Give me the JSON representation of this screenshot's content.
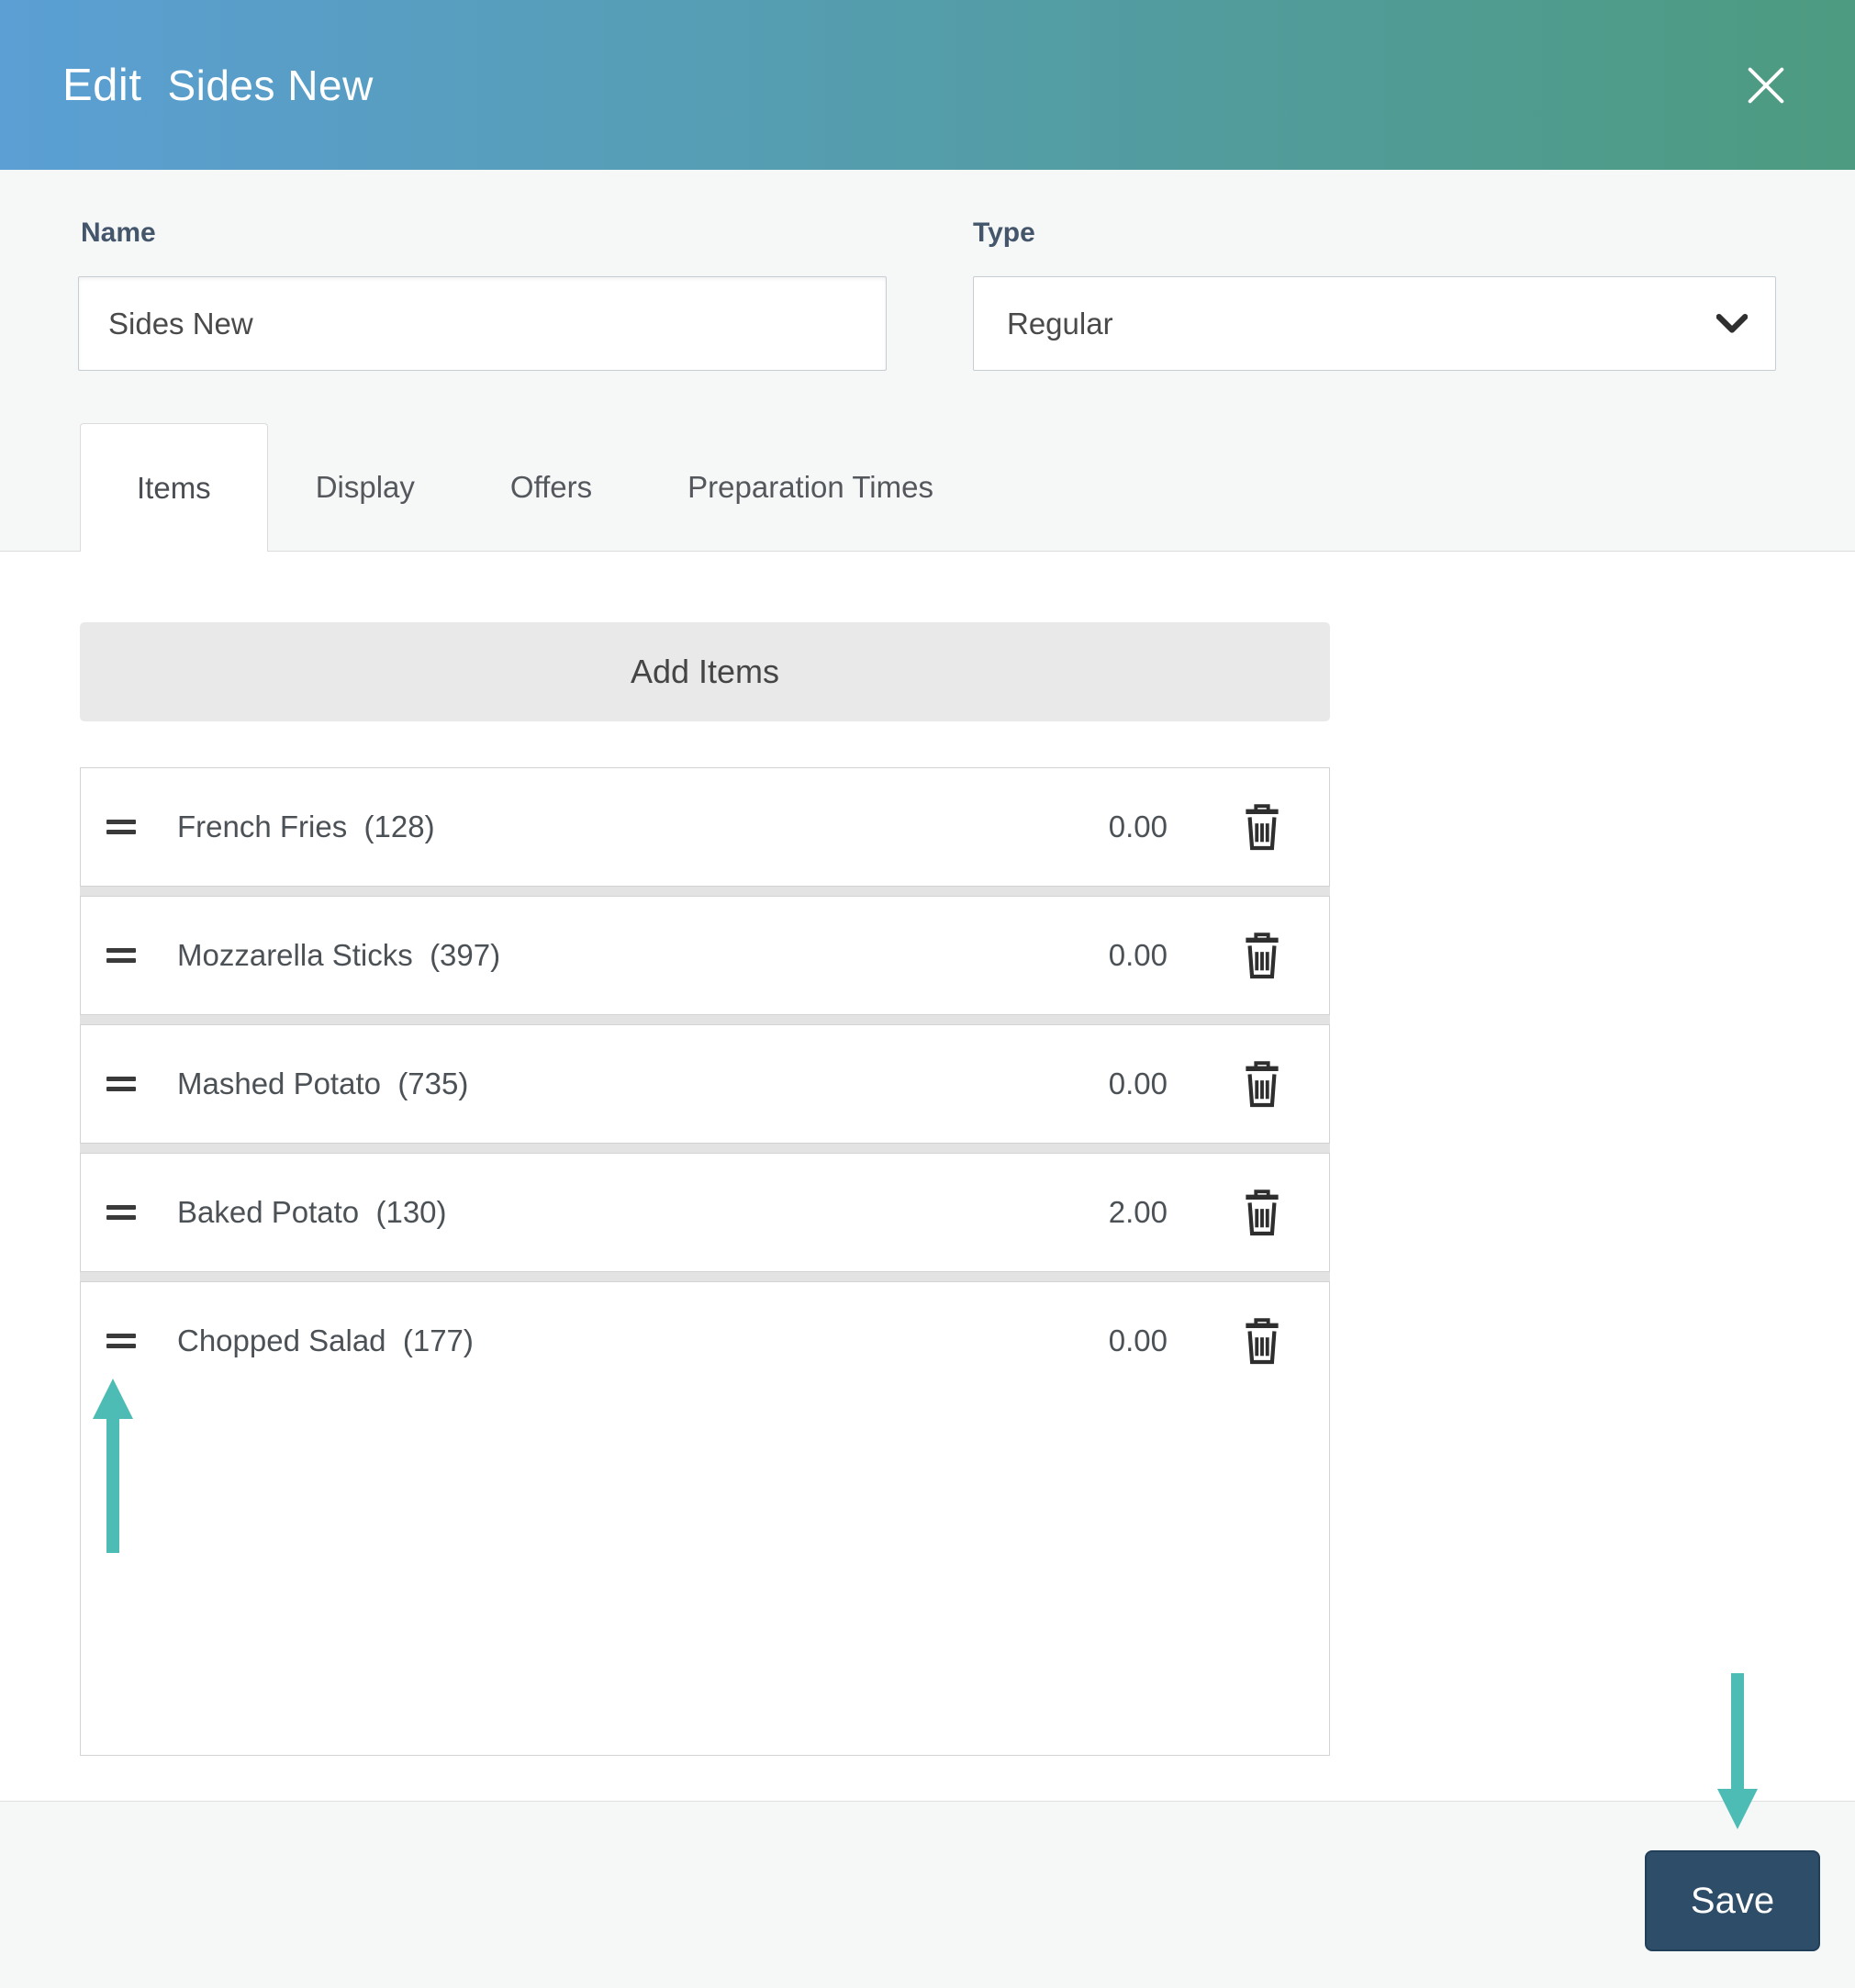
{
  "header": {
    "action": "Edit",
    "entity": "Sides New"
  },
  "form": {
    "name_label": "Name",
    "name_value": "Sides New",
    "type_label": "Type",
    "type_value": "Regular"
  },
  "tabs": [
    {
      "label": "Items",
      "active": true
    },
    {
      "label": "Display",
      "active": false
    },
    {
      "label": "Offers",
      "active": false
    },
    {
      "label": "Preparation Times",
      "active": false
    }
  ],
  "items_section": {
    "add_button_label": "Add Items"
  },
  "items": [
    {
      "label": "French Fries  (128)",
      "price": "0.00"
    },
    {
      "label": "Mozzarella Sticks  (397)",
      "price": "0.00"
    },
    {
      "label": "Mashed Potato  (735)",
      "price": "0.00"
    },
    {
      "label": "Baked Potato  (130)",
      "price": "2.00"
    },
    {
      "label": "Chopped Salad  (177)",
      "price": "0.00"
    }
  ],
  "footer": {
    "save_label": "Save"
  },
  "icons": {
    "close": "close-icon",
    "chevron": "chevron-down-icon",
    "drag": "drag-handle-icon",
    "trash": "trash-icon"
  },
  "colors": {
    "header_grad_start": "#5b9fd4",
    "header_grad_end": "#4d9b80",
    "section_bg": "#f6f7f7",
    "save_btn": "#2e4d68",
    "arrow": "#4cbcb4"
  }
}
